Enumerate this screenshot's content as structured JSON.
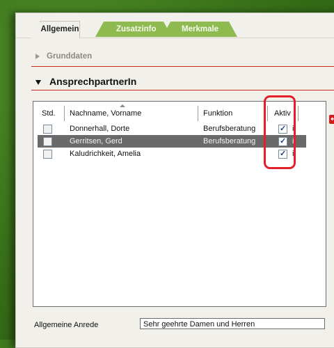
{
  "tabs": [
    {
      "label": "Allgemein",
      "active": true
    },
    {
      "label": "Zusatzinfo",
      "active": false
    },
    {
      "label": "Merkmale",
      "active": false
    }
  ],
  "sections": {
    "grunddaten": "Grunddaten",
    "ansprechpartner": "AnsprechpartnerIn"
  },
  "table": {
    "columns": [
      "Std.",
      "Nachname, Vorname",
      "Funktion",
      "Aktiv"
    ],
    "rows": [
      {
        "std": false,
        "name": "Donnerhall, Dorte",
        "funktion": "Berufsberatung",
        "aktiv": true,
        "extra": "i",
        "selected": false
      },
      {
        "std": false,
        "name": "Gerritsen, Gerd",
        "funktion": "Berufsberatung",
        "aktiv": true,
        "extra": "i",
        "selected": true
      },
      {
        "std": false,
        "name": "Kaludrichkeit, Amelia",
        "funktion": "",
        "aktiv": true,
        "extra": "i",
        "selected": false
      }
    ]
  },
  "footer": {
    "anrede_label": "Allgemeine Anrede",
    "anrede_value": "Sehr geehrte Damen und Herren"
  },
  "colors": {
    "accent_green": "#8dbb4f",
    "section_rule": "#c62a1c",
    "highlight_annotation": "#e3202a"
  },
  "icons": [
    "undo-icon"
  ]
}
